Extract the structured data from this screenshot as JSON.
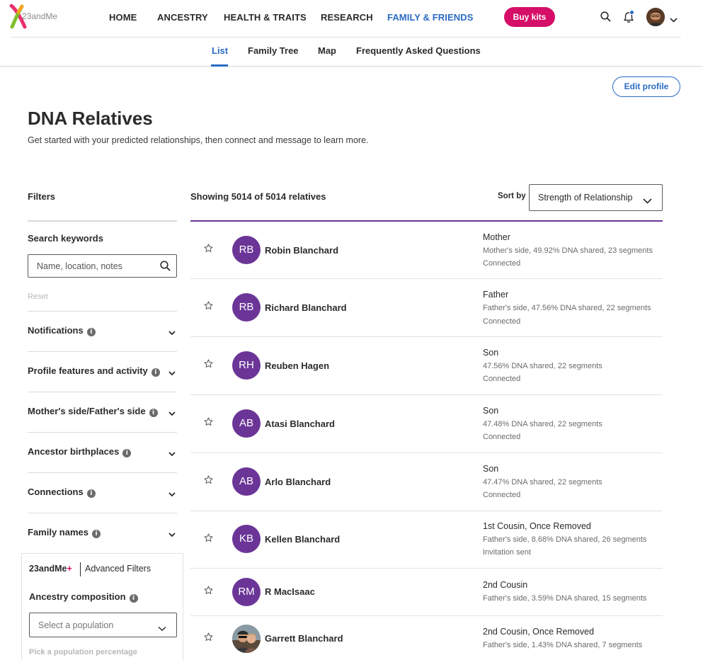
{
  "nav": {
    "logo_text": "23andMe",
    "items": [
      {
        "label": "HOME",
        "active": false
      },
      {
        "label": "ANCESTRY",
        "active": false
      },
      {
        "label": "HEALTH & TRAITS",
        "active": false
      },
      {
        "label": "RESEARCH",
        "active": false
      },
      {
        "label": "FAMILY & FRIENDS",
        "active": true
      }
    ],
    "buy_label": "Buy kits"
  },
  "subnav": {
    "items": [
      {
        "label": "List",
        "active": true
      },
      {
        "label": "Family Tree",
        "active": false
      },
      {
        "label": "Map",
        "active": false
      },
      {
        "label": "Frequently Asked Questions",
        "active": false
      }
    ]
  },
  "edit_profile_label": "Edit profile",
  "page": {
    "title": "DNA Relatives",
    "subtitle": "Get started with your predicted relationships, then connect and message to learn more."
  },
  "filters": {
    "title": "Filters",
    "search_label": "Search keywords",
    "search_placeholder": "Name, location, notes",
    "reset_label": "Reset",
    "groups": [
      {
        "label": "Notifications"
      },
      {
        "label": "Profile features and activity"
      },
      {
        "label": "Mother's side/Father's side"
      },
      {
        "label": "Ancestor birthplaces"
      },
      {
        "label": "Connections"
      },
      {
        "label": "Family names"
      }
    ],
    "advanced": {
      "brand": "23andMe",
      "brand_plus": "+",
      "title": "Advanced Filters",
      "ancestry_label": "Ancestry composition",
      "population_placeholder": "Select a population",
      "pick_label": "Pick a population percentage"
    }
  },
  "results": {
    "showing": "Showing 5014 of 5014 relatives",
    "sort_label": "Sort by",
    "sort_value": "Strength of Relationship",
    "relatives": [
      {
        "initials": "RB",
        "name": "Robin Blanchard",
        "relationship": "Mother",
        "details": "Mother's side, 49.92% DNA shared, 23 segments",
        "status": "Connected"
      },
      {
        "initials": "RB",
        "name": "Richard Blanchard",
        "relationship": "Father",
        "details": "Father's side, 47.56% DNA shared, 22 segments",
        "status": "Connected"
      },
      {
        "initials": "RH",
        "name": "Reuben Hagen",
        "relationship": "Son",
        "details": "47.56% DNA shared, 22 segments",
        "status": "Connected"
      },
      {
        "initials": "AB",
        "name": "Atasi Blanchard",
        "relationship": "Son",
        "details": "47.48% DNA shared, 22 segments",
        "status": "Connected"
      },
      {
        "initials": "AB",
        "name": "Arlo Blanchard",
        "relationship": "Son",
        "details": "47.47% DNA shared, 22 segments",
        "status": "Connected"
      },
      {
        "initials": "KB",
        "name": "Kellen Blanchard",
        "relationship": "1st Cousin, Once Removed",
        "details": "Father's side, 8.68% DNA shared, 26 segments",
        "status": "Invitation sent"
      },
      {
        "initials": "RM",
        "name": "R MacIsaac",
        "relationship": "2nd Cousin",
        "details": "Father's side, 3.59% DNA shared, 15 segments",
        "status": ""
      },
      {
        "initials": "",
        "name": "Garrett Blanchard",
        "relationship": "2nd Cousin, Once Removed",
        "details": "Father's side, 1.43% DNA shared, 7 segments",
        "status": ""
      }
    ]
  },
  "colors": {
    "brand_blue": "#2a6bc4",
    "brand_pink": "#d50f67",
    "avatar_purple": "#6b3597"
  }
}
